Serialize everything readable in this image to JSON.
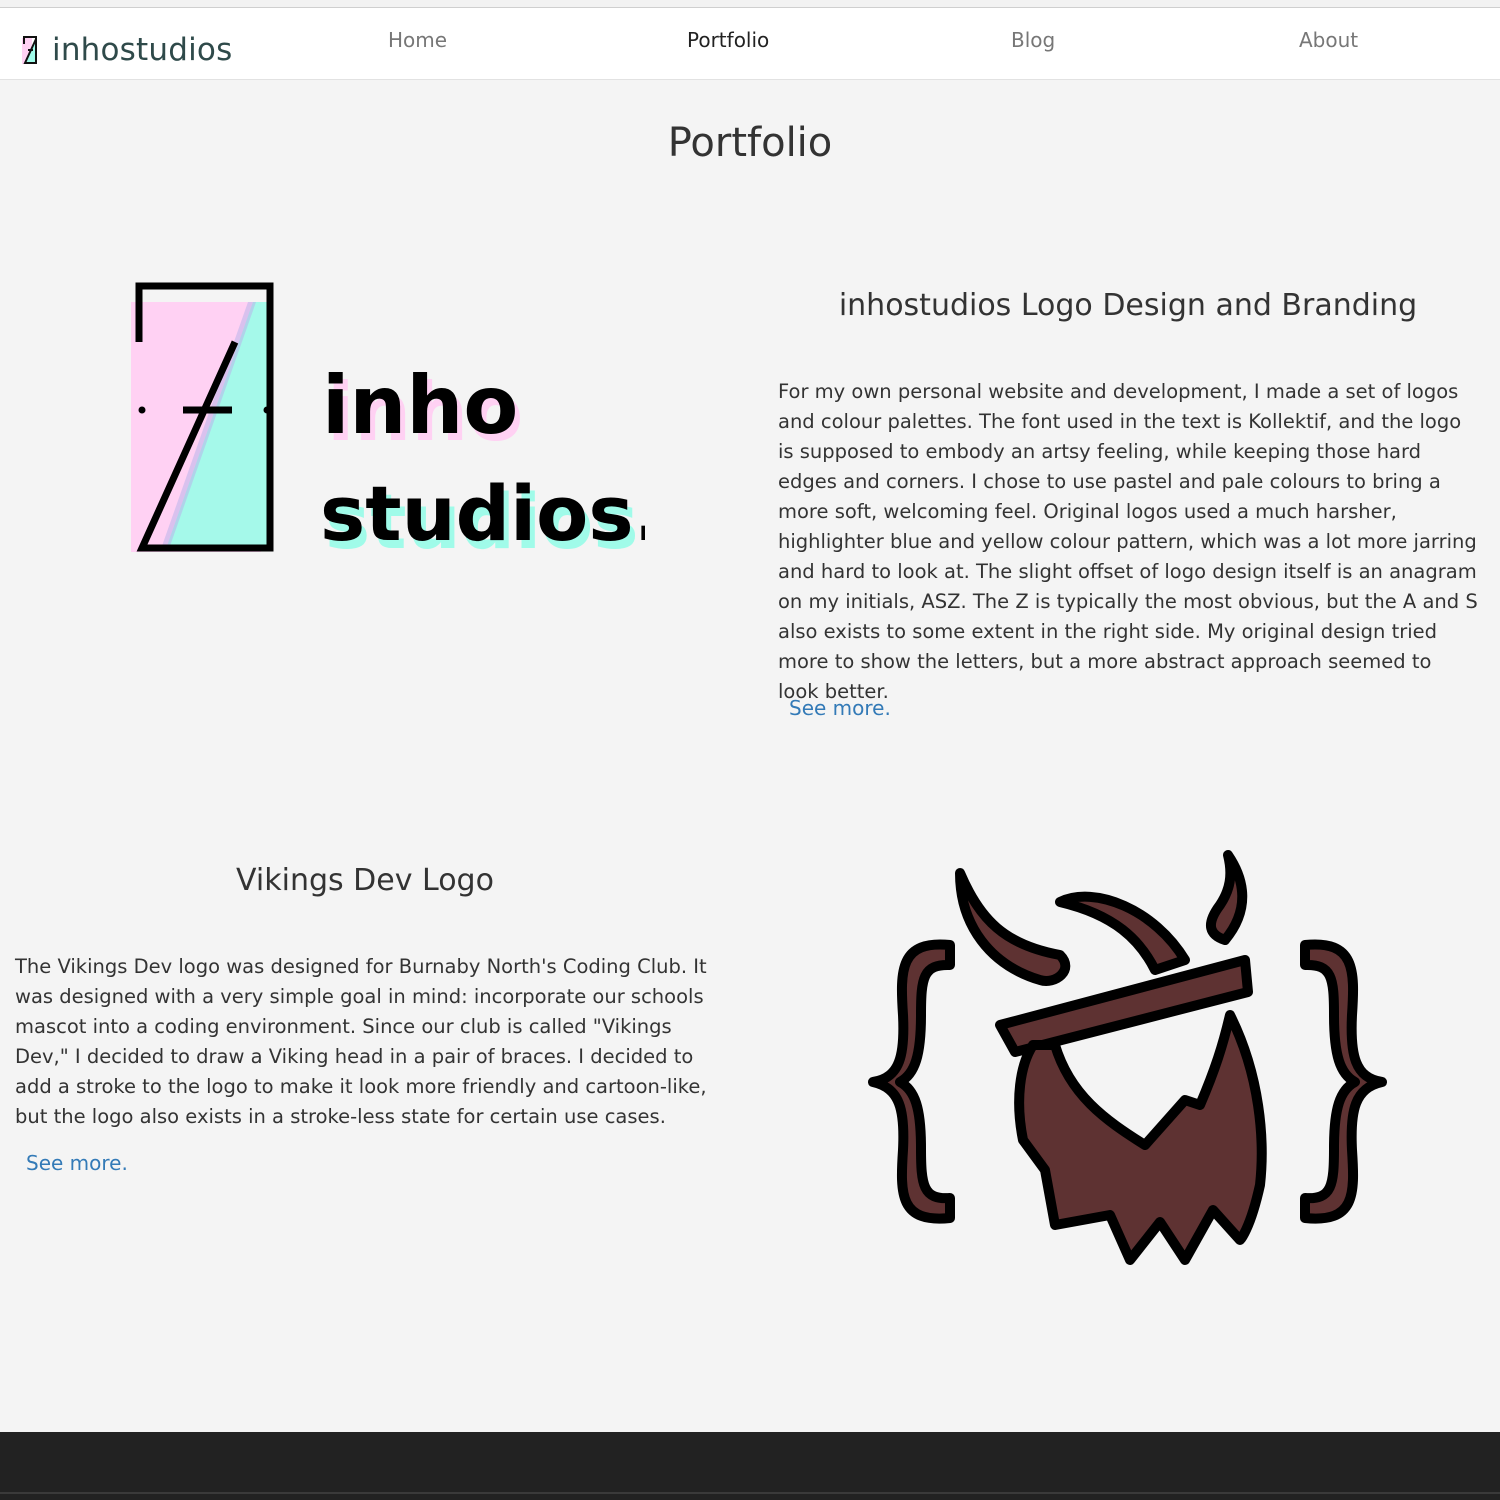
{
  "nav": {
    "brand": "inhostudios",
    "links": [
      {
        "label": "Home",
        "active": false
      },
      {
        "label": "Portfolio",
        "active": true
      },
      {
        "label": "Blog",
        "active": false
      },
      {
        "label": "About",
        "active": false
      }
    ]
  },
  "page": {
    "title": "Portfolio"
  },
  "projects": [
    {
      "title": "inhostudios Logo Design and Branding",
      "description": "For my own personal website and development, I made a set of logos and colour palettes. The font used in the text is Kollektif, and the logo is supposed to embody an artsy feeling, while keeping those hard edges and corners. I chose to use pastel and pale colours to bring a more soft, welcoming feel. Original logos used a much harsher, highlighter blue and yellow colour pattern, which was a lot more jarring and hard to look at. The slight offset of logo design itself is an anagram on my initials, ASZ. The Z is typically the most obvious, but the A and S also exists to some extent in the right side. My original design tried more to show the letters, but a more abstract approach seemed to look better.",
      "link": "See more.",
      "logo_line1": "inho",
      "logo_line2": "studios."
    },
    {
      "title": "Vikings Dev Logo",
      "description": "The Vikings Dev logo was designed for Burnaby North's Coding Club. It was designed with a very simple goal in mind: incorporate our schools mascot into a coding environment. Since our club is called \"Vikings Dev,\" I decided to draw a Viking head in a pair of braces. I decided to add a stroke to the logo to make it look more friendly and cartoon-like, but the logo also exists in a stroke-less state for certain use cases.",
      "link": "See more."
    }
  ],
  "colors": {
    "pink": "#ffd1f3",
    "mint": "#a0fbe9",
    "viking_brown": "#5e3232",
    "link": "#337ab7",
    "footer": "#222222"
  }
}
